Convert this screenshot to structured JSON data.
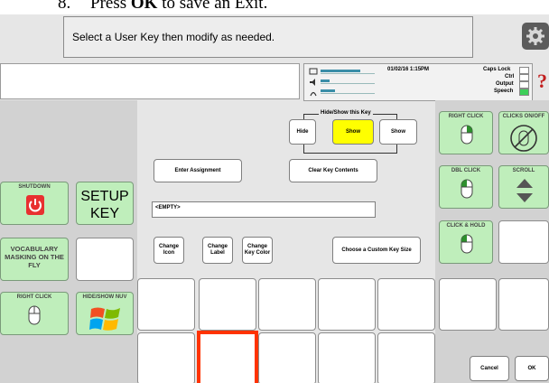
{
  "doc": {
    "step_number": "8.",
    "instruction_prefix": "Press",
    "instruction_bold": "OK",
    "instruction_suffix": "to save an Exit."
  },
  "instruction": "Select a User Key then modify as needed.",
  "status": {
    "datetime": "01/02/16 1:15PM",
    "caps_lock": "Caps Lock",
    "ctrl": "Ctrl",
    "output": "Output",
    "speech": "Speech"
  },
  "help_glyph": "?",
  "left_keys": {
    "shutdown": "SHUTDOWN",
    "setup_key": "SETUP KEY",
    "vocab": "VOCABULARY MASKING ON THE FLY",
    "right_click": "RIGHT CLICK",
    "hide_show_nuv": "HIDE/SHOW NUV"
  },
  "hide_show": {
    "title": "Hide/Show this Key",
    "hide": "Hide",
    "show": "Show",
    "show2": "Show"
  },
  "edit": {
    "enter_assignment": "Enter Assignment",
    "clear_key_contents": "Clear Key Contents",
    "empty": "<EMPTY>",
    "change_icon": "Change Icon",
    "change_label": "Change Label",
    "change_key_color": "Change Key Color",
    "custom_size": "Choose a Custom Key Size"
  },
  "right_keys": {
    "right_click": "RIGHT CLICK",
    "clicks_on_off": "CLICKS ON/OFF",
    "dbl_click": "DBL CLICK",
    "scroll": "SCROLL",
    "click_hold": "CLICK & HOLD"
  },
  "actions": {
    "cancel": "Cancel",
    "ok": "OK"
  },
  "colors": {
    "selected_key_border": "#ff3300",
    "show_active": "#ffff00",
    "green_key": "#bfeebb",
    "shutdown_red": "#e83030"
  }
}
